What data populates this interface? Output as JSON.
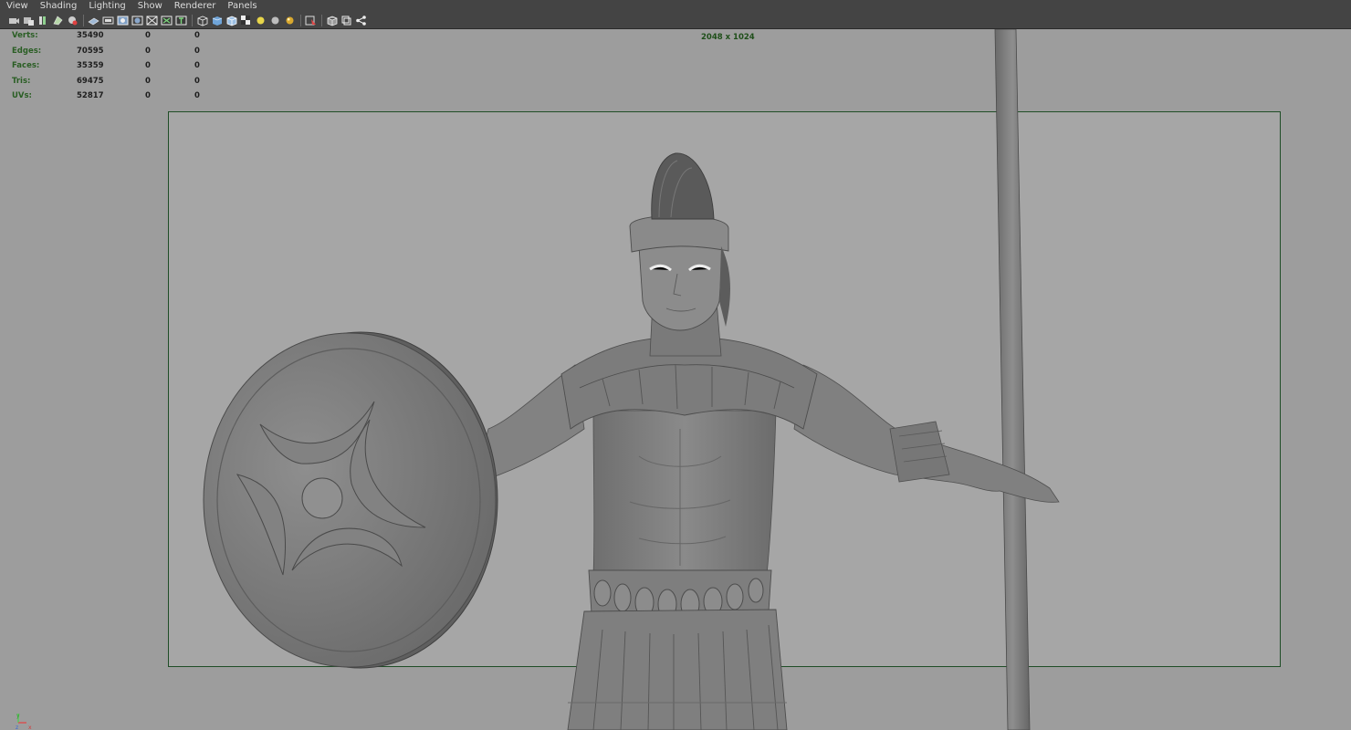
{
  "menu": [
    "View",
    "Shading",
    "Lighting",
    "Show",
    "Renderer",
    "Panels"
  ],
  "toolbar_icons": [
    "camera-select-icon",
    "camera-attributes-icon",
    "bookmark-icon",
    "image-plane-icon",
    "isolate-icon",
    "grid-icon",
    "film-gate-icon",
    "resolution-gate-icon",
    "gate-mask-icon",
    "field-chart-icon",
    "safe-action-icon",
    "safe-title-icon",
    "wireframe-icon",
    "smooth-shade-icon",
    "wireframe-on-shaded-icon",
    "textured-icon",
    "default-light-icon",
    "shadows-icon",
    "high-quality-icon",
    "xray-icon",
    "xray-joints-icon",
    "backface-icon",
    "share-icon"
  ],
  "hud": {
    "rows": [
      {
        "label": "Verts:",
        "v1": "35490",
        "v2": "0",
        "v3": "0"
      },
      {
        "label": "Edges:",
        "v1": "70595",
        "v2": "0",
        "v3": "0"
      },
      {
        "label": "Faces:",
        "v1": "35359",
        "v2": "0",
        "v3": "0"
      },
      {
        "label": "Tris:",
        "v1": "69475",
        "v2": "0",
        "v3": "0"
      },
      {
        "label": "UVs:",
        "v1": "52817",
        "v2": "0",
        "v3": "0"
      }
    ]
  },
  "resolution": "2048 x 1024",
  "axis": {
    "y": "y",
    "z": "z",
    "x": "x"
  },
  "colors": {
    "viewport": "#9d9d9d",
    "gate": "#1f4d26",
    "menubar": "#444444",
    "hud_label": "#2a5e24"
  }
}
